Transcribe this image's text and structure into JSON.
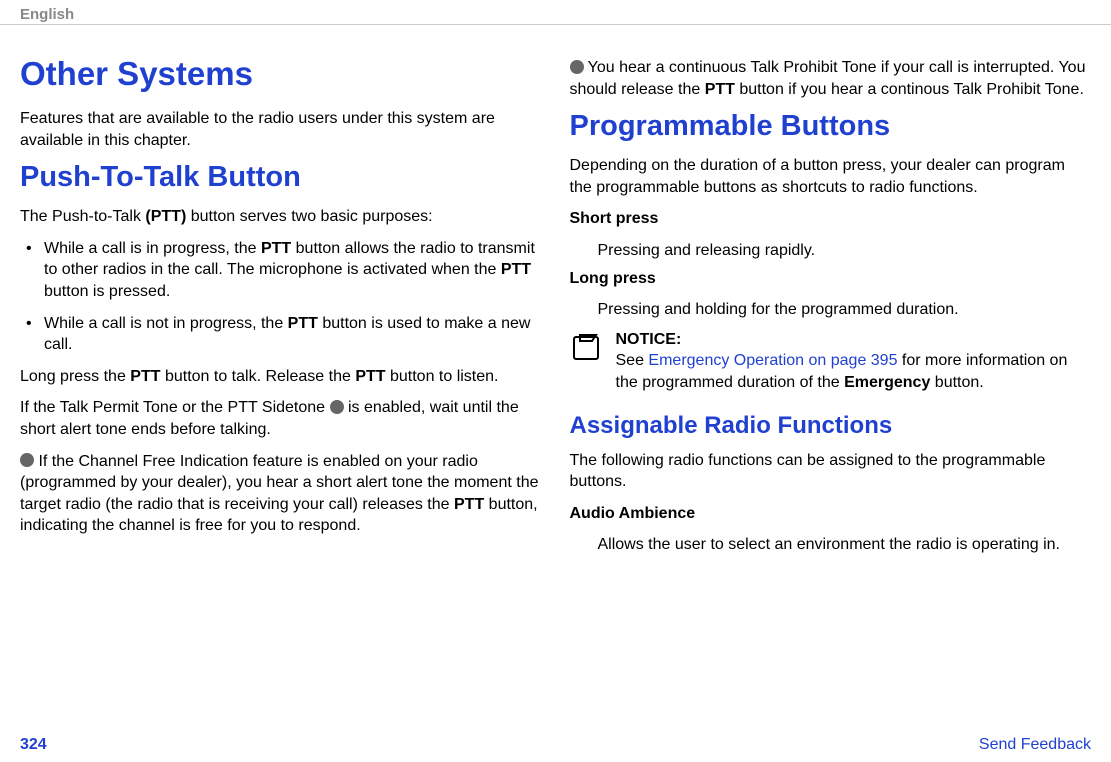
{
  "header": {
    "language": "English"
  },
  "left": {
    "h1": "Other Systems",
    "intro": "Features that are available to the radio users under this system are available in this chapter.",
    "h2": "Push-To-Talk Button",
    "ptt_intro_pre": "The Push-to-Talk ",
    "ptt_intro_bold": "(PTT)",
    "ptt_intro_post": " button serves two basic purposes:",
    "bullets": [
      {
        "pre": "While a call is in progress, the ",
        "b1": "PTT",
        "mid1": " button allows the radio to transmit to other radios in the call. The microphone is activated when the ",
        "b2": "PTT",
        "post": " button is pressed."
      },
      {
        "pre": "While a call is not in progress, the ",
        "b1": "PTT",
        "post": " button is used to make a new call."
      }
    ],
    "longpress_pre": "Long press the ",
    "longpress_b1": "PTT",
    "longpress_mid": " button to talk. Release the ",
    "longpress_b2": "PTT",
    "longpress_post": " button to listen.",
    "sidetone_pre": "If the Talk Permit Tone or the PTT Sidetone ",
    "sidetone_post": " is enabled, wait until the short alert tone ends before talking.",
    "channelfree_pre": " If the Channel Free Indication feature is enabled on your radio (programmed by your dealer), you hear a short alert tone the moment the target radio (the radio that is receiving your call) releases the ",
    "channelfree_b": "PTT",
    "channelfree_post": " button, indicating the channel is free for you to respond."
  },
  "right": {
    "prohibit_pre": " You hear a continuous Talk Prohibit Tone if your call is interrupted. You should release the ",
    "prohibit_b": "PTT",
    "prohibit_post": " button if you hear a continous Talk Prohibit Tone.",
    "h2": "Programmable Buttons",
    "prog_intro": "Depending on the duration of a button press, your dealer can program the programmable buttons as shortcuts to radio functions.",
    "short_dt": "Short press",
    "short_dd": "Pressing and releasing rapidly.",
    "long_dt": "Long press",
    "long_dd": "Pressing and holding for the programmed duration.",
    "notice_title": "NOTICE:",
    "notice_pre": "See ",
    "notice_link": "Emergency Operation on page 395",
    "notice_mid": " for more information on the programmed duration of the ",
    "notice_b": "Emergency",
    "notice_post": " button.",
    "h3": "Assignable Radio Functions",
    "assign_intro": "The following radio functions can be assigned to the programmable buttons.",
    "aa_dt": "Audio Ambience",
    "aa_dd": "Allows the user to select an environment the radio is operating in."
  },
  "footer": {
    "page": "324",
    "feedback": "Send Feedback"
  }
}
